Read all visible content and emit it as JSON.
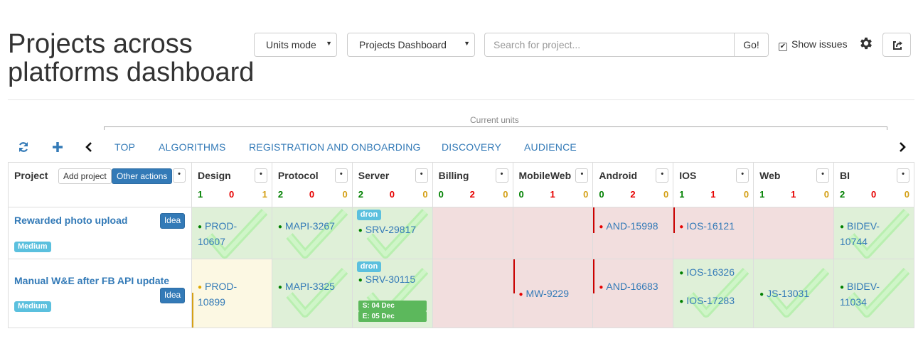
{
  "header": {
    "title_line1": "Projects across",
    "title_line2": "platforms dashboard",
    "units_mode": "Units mode",
    "dashboard_select": "Projects Dashboard",
    "search_placeholder": "Search for project...",
    "go_label": "Go!",
    "show_issues_label": "Show issues",
    "show_issues_checked": true
  },
  "units": {
    "label": "Current units",
    "tabs": [
      "TOP",
      "ALGORITHMS",
      "REGISTRATION AND ONBOARDING",
      "DISCOVERY",
      "AUDIENCE"
    ]
  },
  "table": {
    "project_header": "Project",
    "add_project_label": "Add project",
    "other_actions_label": "Other actions",
    "dots": "•",
    "columns": [
      {
        "name": "Design",
        "counts": [
          "1",
          "0",
          "1"
        ]
      },
      {
        "name": "Protocol",
        "counts": [
          "2",
          "0",
          "0"
        ]
      },
      {
        "name": "Server",
        "counts": [
          "2",
          "0",
          "0"
        ]
      },
      {
        "name": "Billing",
        "counts": [
          "0",
          "2",
          "0"
        ]
      },
      {
        "name": "MobileWeb",
        "counts": [
          "0",
          "1",
          "0"
        ]
      },
      {
        "name": "Android",
        "counts": [
          "0",
          "2",
          "0"
        ]
      },
      {
        "name": "IOS",
        "counts": [
          "1",
          "1",
          "0"
        ]
      },
      {
        "name": "Web",
        "counts": [
          "1",
          "1",
          "0"
        ]
      },
      {
        "name": "BI",
        "counts": [
          "2",
          "0",
          "0"
        ]
      }
    ],
    "rows": [
      {
        "name": "Rewarded photo upload",
        "type_label": "Idea",
        "priority": "Medium",
        "cells": {
          "design": [
            "PROD-",
            "10607"
          ],
          "protocol": "MAPI-3267",
          "server_tag": "dron",
          "server": "SRV-29817",
          "android": "AND-15998",
          "ios": "IOS-16121",
          "bi": [
            "BIDEV-",
            "10744"
          ]
        }
      },
      {
        "name": "Manual W&E after FB API update",
        "type_label": "Idea",
        "priority": "Medium",
        "cells": {
          "design": [
            "PROD-",
            "10899"
          ],
          "protocol": "MAPI-3325",
          "server_tag": "dron",
          "server": "SRV-30115",
          "server_start": "S: 04 Dec",
          "server_end": "E: 05 Dec",
          "mobileweb": "MW-9229",
          "android": "AND-16683",
          "ios_1": "IOS-16326",
          "ios_2": "IOS-17283",
          "web": "JS-13031",
          "bi": [
            "BIDEV-",
            "11034"
          ]
        }
      }
    ]
  },
  "icons": [
    "refresh-icon",
    "plus-icon",
    "chevron-left-icon",
    "chevron-right-icon",
    "gear-icon",
    "share-icon",
    "checkmark-icon",
    "bullet-icon"
  ],
  "colors": {
    "link": "#337ab7",
    "done": "#dff0d8",
    "blocked": "#f2dede",
    "in_progress": "#fcf8e3",
    "ok": "#008000",
    "error": "#e60000",
    "warn": "#d4a017"
  }
}
